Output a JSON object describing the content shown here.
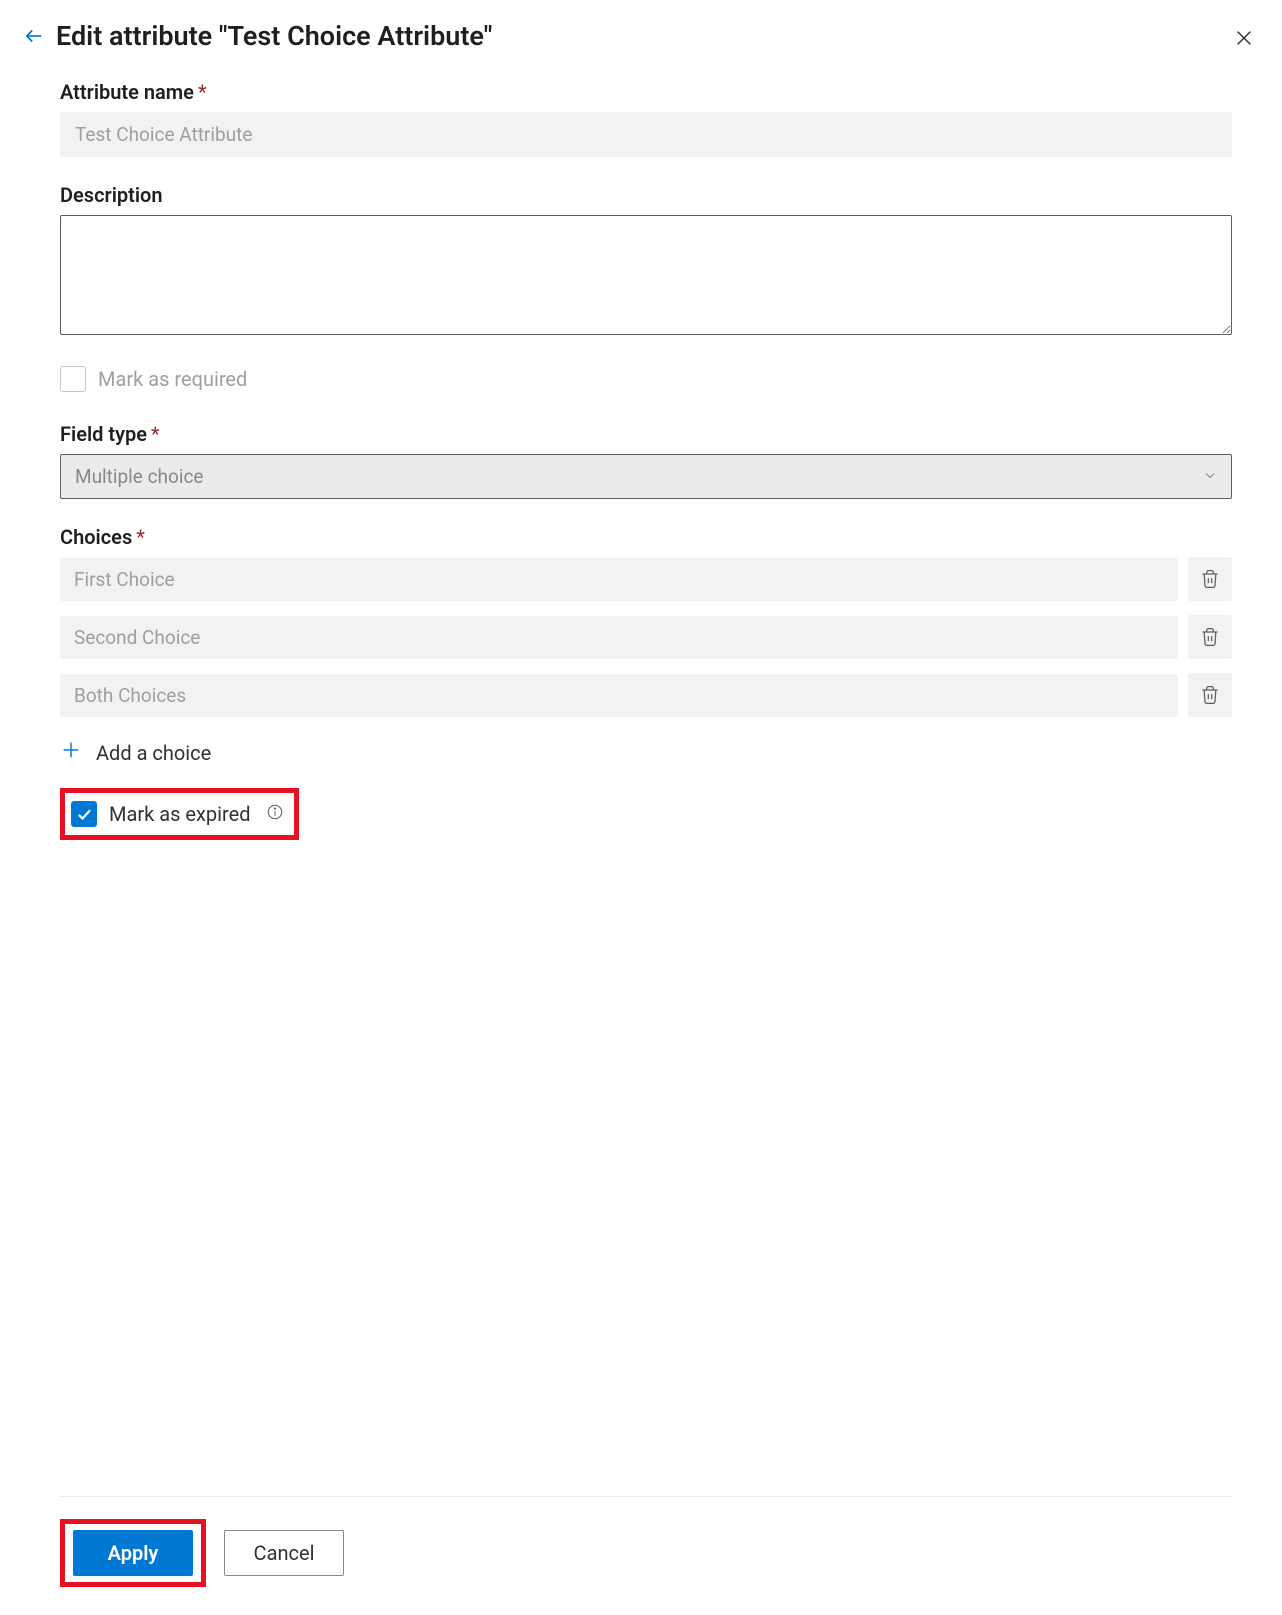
{
  "header": {
    "title": "Edit attribute \"Test Choice Attribute\""
  },
  "form": {
    "attribute_name_label": "Attribute name",
    "attribute_name_value": "Test Choice Attribute",
    "description_label": "Description",
    "description_value": "",
    "mark_required_label": "Mark as required",
    "mark_required_checked": false,
    "field_type_label": "Field type",
    "field_type_value": "Multiple choice",
    "choices_label": "Choices",
    "choices": [
      {
        "value": "First Choice"
      },
      {
        "value": "Second Choice"
      },
      {
        "value": "Both Choices"
      }
    ],
    "add_choice_label": "Add a choice",
    "mark_expired_label": "Mark as expired",
    "mark_expired_checked": true
  },
  "footer": {
    "apply_label": "Apply",
    "cancel_label": "Cancel"
  }
}
